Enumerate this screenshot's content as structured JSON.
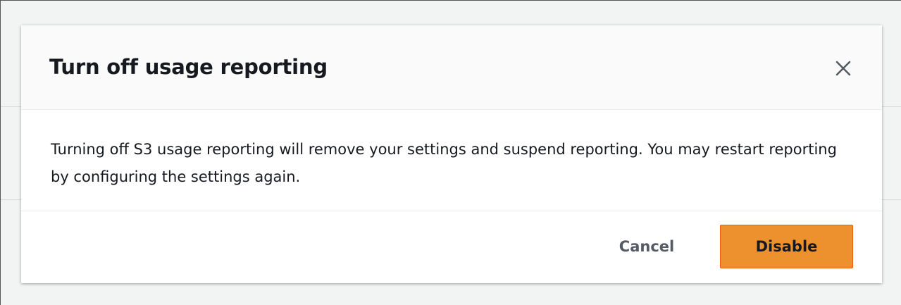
{
  "modal": {
    "title": "Turn off usage reporting",
    "body": "Turning off S3 usage reporting will remove your settings and suspend reporting. You may restart reporting by configuring the settings again.",
    "cancel_label": "Cancel",
    "confirm_label": "Disable",
    "close_icon": "close-icon"
  },
  "colors": {
    "primary_button": "#ec912d",
    "overlay_background": "#f2f3f3"
  }
}
